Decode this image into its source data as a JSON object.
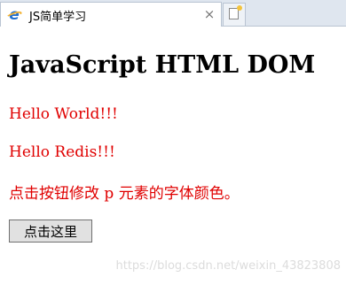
{
  "browser": {
    "tab_title": "JS简单学习",
    "tab_close": "×",
    "favicon": "e"
  },
  "page": {
    "heading": "JavaScript HTML DOM",
    "paragraphs": [
      "Hello World!!!",
      "Hello Redis!!!",
      "点击按钮修改 p 元素的字体颜色。"
    ],
    "paragraph_color": "#e00000",
    "button_label": "点击这里"
  },
  "watermark": "https://blog.csdn.net/weixin_43823808"
}
